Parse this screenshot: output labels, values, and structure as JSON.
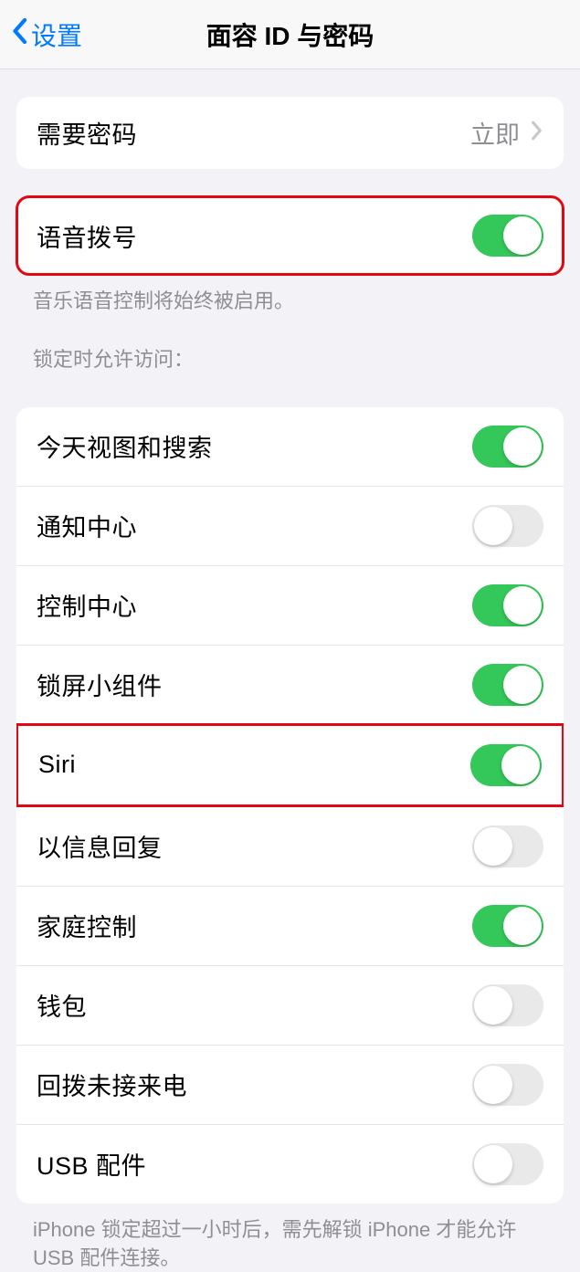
{
  "header": {
    "back_label": "设置",
    "title": "面容 ID 与密码"
  },
  "passcode_section": {
    "label": "需要密码",
    "value": "立即"
  },
  "voice_dial": {
    "label": "语音拨号",
    "on": true,
    "footer": "音乐语音控制将始终被启用。"
  },
  "locked_access": {
    "header": "锁定时允许访问：",
    "items": [
      {
        "label": "今天视图和搜索",
        "on": true,
        "highlighted": false
      },
      {
        "label": "通知中心",
        "on": false,
        "highlighted": false
      },
      {
        "label": "控制中心",
        "on": true,
        "highlighted": false
      },
      {
        "label": "锁屏小组件",
        "on": true,
        "highlighted": false
      },
      {
        "label": "Siri",
        "on": true,
        "highlighted": true
      },
      {
        "label": "以信息回复",
        "on": false,
        "highlighted": false
      },
      {
        "label": "家庭控制",
        "on": true,
        "highlighted": false
      },
      {
        "label": "钱包",
        "on": false,
        "highlighted": false
      },
      {
        "label": "回拨未接来电",
        "on": false,
        "highlighted": false
      },
      {
        "label": "USB 配件",
        "on": false,
        "highlighted": false
      }
    ],
    "footer": "iPhone 锁定超过一小时后，需先解锁 iPhone 才能允许 USB 配件连接。"
  }
}
